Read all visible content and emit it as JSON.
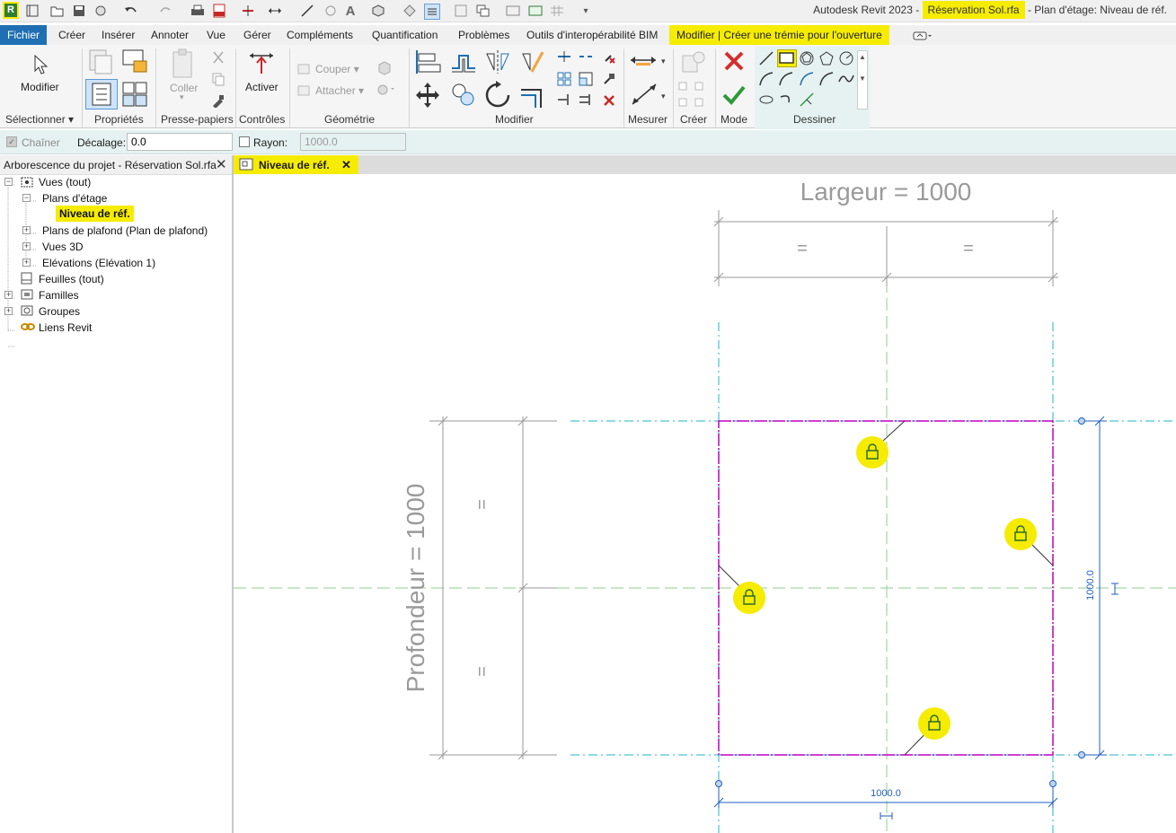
{
  "titlebar": {
    "app": "Autodesk Revit 2023 -",
    "file": "Réservation Sol.rfa",
    "view": "- Plan d'étage: Niveau de réf."
  },
  "tabs": {
    "file": "Fichier",
    "items": [
      "Créer",
      "Insérer",
      "Annoter",
      "Vue",
      "Gérer",
      "Compléments",
      "Quantification",
      "Problèmes",
      "Outils d'interopérabilité BIM"
    ],
    "context": "Modifier | Créer une trémie pour l'ouverture"
  },
  "ribbon": {
    "modifier": "Modifier",
    "selectionner": "Sélectionner",
    "proprietes": "Propriétés",
    "coller": "Coller",
    "presse_papiers": "Presse-papiers",
    "activer": "Activer",
    "controles": "Contrôles",
    "couper": "Couper",
    "attacher": "Attacher",
    "geometrie": "Géométrie",
    "modifier_panel": "Modifier",
    "mesurer": "Mesurer",
    "creer": "Créer",
    "mode": "Mode",
    "dessiner": "Dessiner"
  },
  "options": {
    "chainer": "Chaîner",
    "decalage_label": "Décalage:",
    "decalage_value": "0.0",
    "rayon_label": "Rayon:",
    "rayon_value": "1000.0"
  },
  "browser": {
    "title": "Arborescence du projet - Réservation Sol.rfa",
    "items": {
      "vues": "Vues (tout)",
      "plans_etage": "Plans d'étage",
      "niveau": "Niveau de réf.",
      "plans_plafond": "Plans de plafond (Plan de plafond)",
      "vues3d": "Vues 3D",
      "elevations": "Elévations (Elévation 1)",
      "feuilles": "Feuilles (tout)",
      "familles": "Familles",
      "groupes": "Groupes",
      "liens": "Liens Revit"
    }
  },
  "view_tab": "Niveau de réf.",
  "drawing": {
    "largeur": "Largeur = 1000",
    "profondeur": "Profondeur = 1000",
    "eq": "=",
    "dim_bottom": "1000.0",
    "dim_right": "1000.0"
  },
  "colors": {
    "highlight": "#f5ec00",
    "sketch": "#c000c0",
    "refplane": "#1fb5c8",
    "dimension": "#1f5fbf",
    "center": "#7fc97f"
  }
}
